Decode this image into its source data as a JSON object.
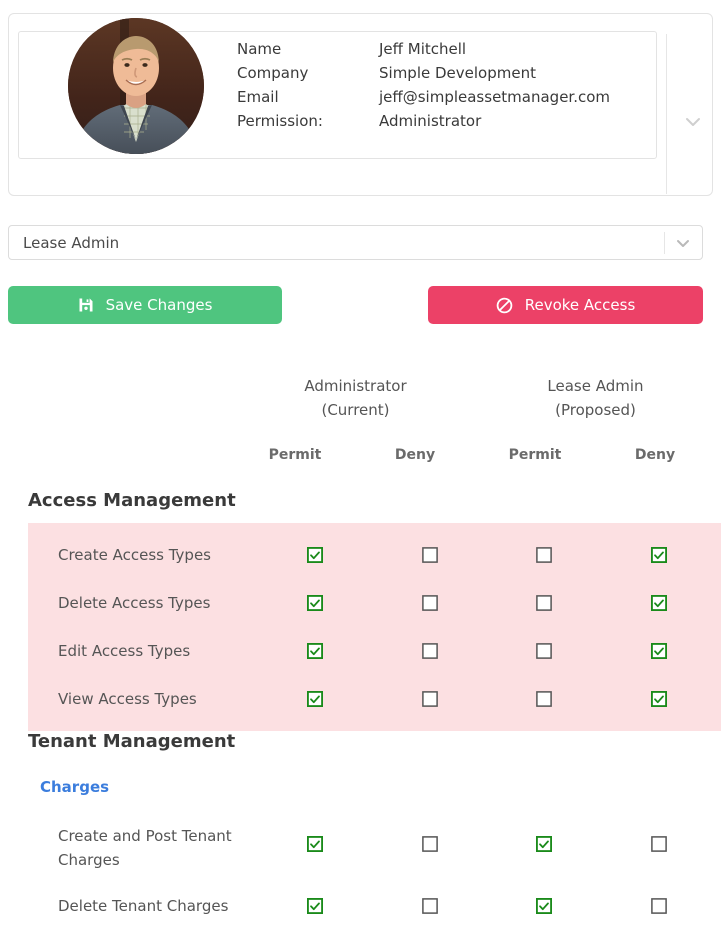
{
  "profile": {
    "avatar_name": "user-avatar-photo",
    "fields": [
      {
        "label": "Name",
        "value": "Jeff Mitchell"
      },
      {
        "label": "Company",
        "value": "Simple Development"
      },
      {
        "label": "Email",
        "value": "jeff@simpleassetmanager.com"
      },
      {
        "label": "Permission:",
        "value": "Administrator"
      }
    ],
    "expand_icon": "chevron-down-icon"
  },
  "role_select": {
    "value": "Lease Admin",
    "chevron_icon": "chevron-down-icon"
  },
  "actions": {
    "save": {
      "label": "Save Changes",
      "icon": "save-icon",
      "color": "#4fc57f"
    },
    "revoke": {
      "label": "Revoke Access",
      "icon": "ban-icon",
      "color": "#ec4167"
    }
  },
  "table": {
    "group_headers": [
      {
        "title": "Administrator",
        "subtitle": "(Current)"
      },
      {
        "title": "Lease Admin",
        "subtitle": "(Proposed)"
      }
    ],
    "columns": [
      "Permit",
      "Deny",
      "Permit",
      "Deny"
    ],
    "sections": [
      {
        "title": "Access Management",
        "highlight": true,
        "subgroup": null,
        "rows": [
          {
            "label": "Create Access Types",
            "states": [
              true,
              false,
              false,
              true
            ]
          },
          {
            "label": "Delete Access Types",
            "states": [
              true,
              false,
              false,
              true
            ]
          },
          {
            "label": "Edit Access Types",
            "states": [
              true,
              false,
              false,
              true
            ]
          },
          {
            "label": "View Access Types",
            "states": [
              true,
              false,
              false,
              true
            ]
          }
        ]
      },
      {
        "title": "Tenant Management",
        "highlight": false,
        "subgroup": "Charges",
        "rows": [
          {
            "label": "Create and Post Tenant Charges",
            "states": [
              true,
              false,
              true,
              false
            ],
            "tall": true
          },
          {
            "label": "Delete Tenant Charges",
            "states": [
              true,
              false,
              true,
              false
            ],
            "tall": false
          }
        ]
      }
    ]
  },
  "colors": {
    "checkbox_checked_border": "#1a8a1a",
    "checkbox_unchecked_border": "#555555",
    "danger_row_bg": "#fce0e2",
    "link_blue": "#3b7ddd"
  }
}
